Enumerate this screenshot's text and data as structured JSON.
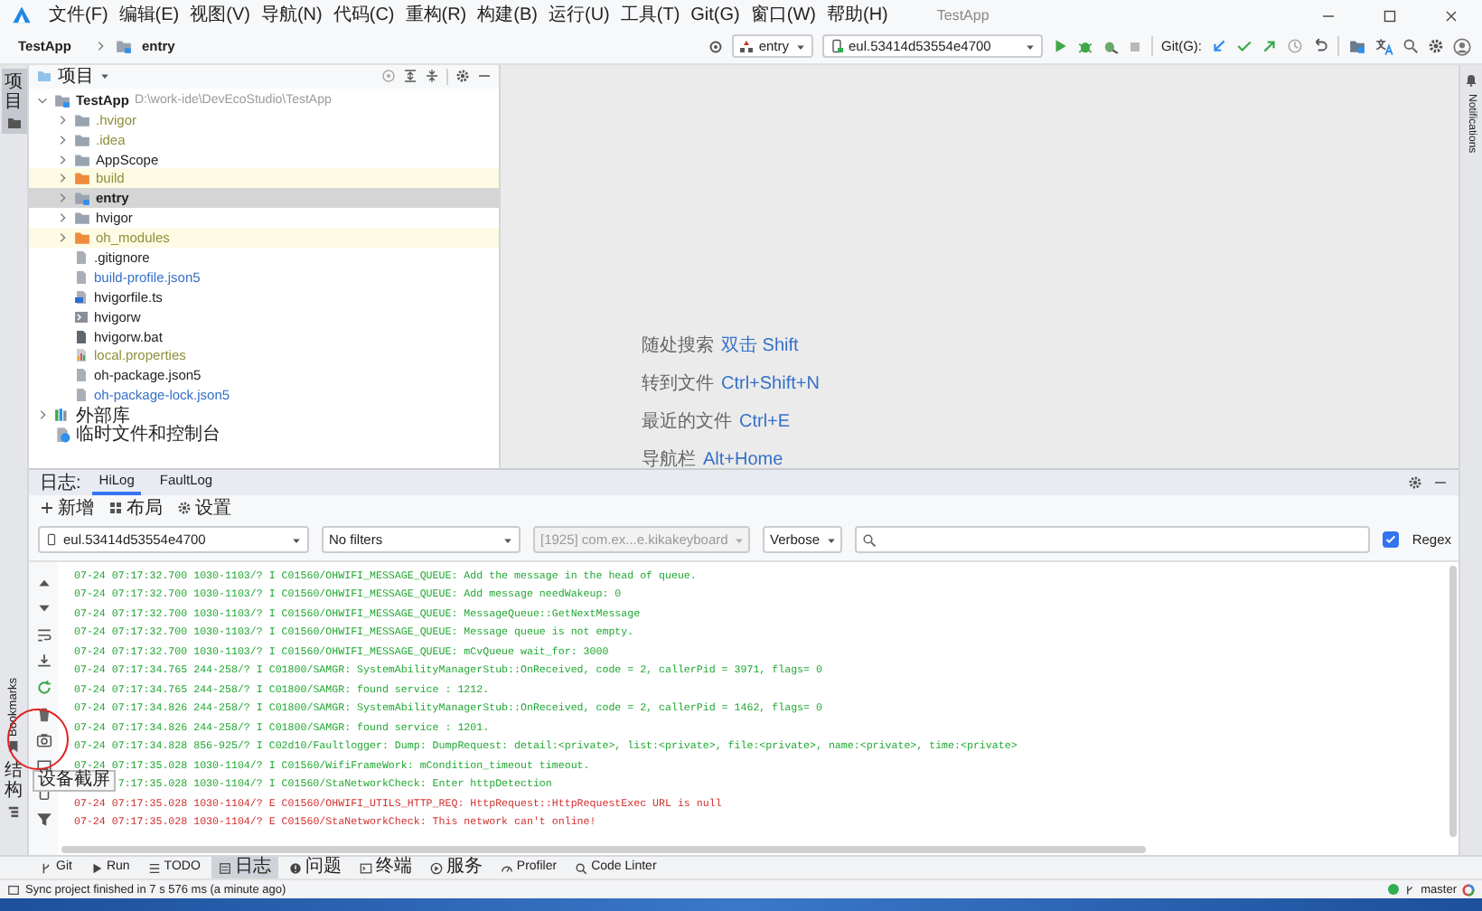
{
  "title_bar": {
    "menus": [
      "文件(F)",
      "编辑(E)",
      "视图(V)",
      "导航(N)",
      "代码(C)",
      "重构(R)",
      "构建(B)",
      "运行(U)",
      "工具(T)",
      "Git(G)",
      "窗口(W)",
      "帮助(H)"
    ],
    "title": "TestApp"
  },
  "navigation_bar": {
    "breadcrumbs": [
      "TestApp",
      "entry"
    ],
    "run_config": "entry",
    "device": "eul.53414d53554e4700",
    "git_label": "Git(G):"
  },
  "left_strip": {
    "tabs": [
      {
        "label": "项目",
        "kind": "vertical-cjk",
        "selected": true
      },
      {
        "label": "Bookmarks",
        "kind": "rotated",
        "selected": false
      },
      {
        "label": "结构",
        "kind": "vertical-cjk",
        "selected": false
      }
    ]
  },
  "right_strip": {
    "tabs": [
      "Notifications"
    ]
  },
  "project_panel": {
    "view": "项目",
    "tree": [
      {
        "name": "TestApp",
        "path": "D:\\work-ide\\DevEcoStudio\\TestApp",
        "kind": "module",
        "ignored": false,
        "modified": false,
        "selected": false,
        "excluded": false,
        "expanded": true,
        "children": [
          {
            "name": ".hvigor",
            "kind": "folder",
            "ignored": true,
            "modified": false,
            "selected": false,
            "excluded": false,
            "expanded": false
          },
          {
            "name": ".idea",
            "kind": "folder",
            "ignored": true,
            "modified": false,
            "selected": false,
            "excluded": false,
            "expanded": false
          },
          {
            "name": "AppScope",
            "kind": "folder",
            "ignored": false,
            "modified": false,
            "selected": false,
            "excluded": false,
            "expanded": false
          },
          {
            "name": "build",
            "kind": "excluded-folder",
            "ignored": true,
            "modified": false,
            "selected": false,
            "excluded": true,
            "expanded": false
          },
          {
            "name": "entry",
            "kind": "module",
            "ignored": false,
            "modified": false,
            "selected": true,
            "excluded": false,
            "expanded": false
          },
          {
            "name": "hvigor",
            "kind": "folder",
            "ignored": false,
            "modified": false,
            "selected": false,
            "excluded": false,
            "expanded": false
          },
          {
            "name": "oh_modules",
            "kind": "excluded-folder",
            "ignored": true,
            "modified": false,
            "selected": false,
            "excluded": true,
            "expanded": false
          },
          {
            "name": ".gitignore",
            "kind": "file",
            "ignored": false,
            "modified": false,
            "selected": false,
            "excluded": false
          },
          {
            "name": "build-profile.json5",
            "kind": "file",
            "ignored": false,
            "modified": true,
            "selected": false,
            "excluded": false
          },
          {
            "name": "hvigorfile.ts",
            "kind": "ts",
            "ignored": false,
            "modified": false,
            "selected": false,
            "excluded": false
          },
          {
            "name": "hvigorw",
            "kind": "script",
            "ignored": false,
            "modified": false,
            "selected": false,
            "excluded": false
          },
          {
            "name": "hvigorw.bat",
            "kind": "bat",
            "ignored": false,
            "modified": false,
            "selected": false,
            "excluded": false
          },
          {
            "name": "local.properties",
            "kind": "properties",
            "ignored": true,
            "modified": false,
            "selected": false,
            "excluded": false
          },
          {
            "name": "oh-package.json5",
            "kind": "file",
            "ignored": false,
            "modified": false,
            "selected": false,
            "excluded": false
          },
          {
            "name": "oh-package-lock.json5",
            "kind": "file",
            "ignored": false,
            "modified": true,
            "selected": false,
            "excluded": false
          }
        ]
      },
      {
        "name": "外部库",
        "kind": "library",
        "ignored": false,
        "modified": false,
        "selected": false,
        "excluded": false,
        "expanded": false
      },
      {
        "name": "临时文件和控制台",
        "kind": "scratch",
        "ignored": false,
        "modified": false,
        "selected": false,
        "excluded": false
      }
    ]
  },
  "editor_hints": [
    {
      "action": "随处搜索",
      "shortcut": "双击 Shift"
    },
    {
      "action": "转到文件",
      "shortcut": "Ctrl+Shift+N"
    },
    {
      "action": "最近的文件",
      "shortcut": "Ctrl+E"
    },
    {
      "action": "导航栏",
      "shortcut": "Alt+Home"
    }
  ],
  "log_panel": {
    "label": "日志:",
    "tabs": [
      {
        "label": "HiLog",
        "selected": true
      },
      {
        "label": "FaultLog",
        "selected": false
      }
    ],
    "actions": [
      "新增",
      "布局",
      "设置"
    ],
    "device": "eul.53414d53554e4700",
    "filter": "No filters",
    "process": {
      "text": "[1925] com.ex...e.kikakeyboard",
      "disabled": true
    },
    "log_level": "Verbose",
    "regex": {
      "label": "Regex",
      "checked": true
    },
    "lines": [
      {
        "kind": "info",
        "covered": false,
        "text": "07-24 07:17:32.700 1030-1103/? I C01560/OHWIFI_MESSAGE_QUEUE: Add the message in the head of queue."
      },
      {
        "kind": "info",
        "covered": false,
        "text": "07-24 07:17:32.700 1030-1103/? I C01560/OHWIFI_MESSAGE_QUEUE: Add message needWakeup: 0"
      },
      {
        "kind": "info",
        "covered": false,
        "text": "07-24 07:17:32.700 1030-1103/? I C01560/OHWIFI_MESSAGE_QUEUE: MessageQueue::GetNextMessage"
      },
      {
        "kind": "info",
        "covered": false,
        "text": "07-24 07:17:32.700 1030-1103/? I C01560/OHWIFI_MESSAGE_QUEUE: Message queue is not empty."
      },
      {
        "kind": "info",
        "covered": false,
        "text": "07-24 07:17:32.700 1030-1103/? I C01560/OHWIFI_MESSAGE_QUEUE: mCvQueue wait_for: 3000"
      },
      {
        "kind": "info",
        "covered": false,
        "text": "07-24 07:17:34.765 244-258/? I C01800/SAMGR: SystemAbilityManagerStub::OnReceived, code = 2, callerPid = 3971, flags= 0"
      },
      {
        "kind": "info",
        "covered": false,
        "text": "07-24 07:17:34.765 244-258/? I C01800/SAMGR: found service : 1212."
      },
      {
        "kind": "info",
        "covered": false,
        "text": "07-24 07:17:34.826 244-258/? I C01800/SAMGR: SystemAbilityManagerStub::OnReceived, code = 2, callerPid = 1462, flags= 0"
      },
      {
        "kind": "info",
        "covered": false,
        "text": "07-24 07:17:34.826 244-258/? I C01800/SAMGR: found service : 1201."
      },
      {
        "kind": "info",
        "covered": false,
        "text": "07-24 07:17:34.828 856-925/? I C02d10/Faultlogger: Dump: DumpRequest: detail:<private>, list:<private>, file:<private>, name:<private>, time:<private>"
      },
      {
        "kind": "info",
        "covered": false,
        "text": "07-24 07:17:35.028 1030-1104/? I C01560/WifiFrameWork: mCondition_timeout timeout."
      },
      {
        "kind": "info",
        "covered": true,
        "text": "7:17:35.028 1030-1104/? I C01560/StaNetworkCheck: Enter httpDetection"
      },
      {
        "kind": "error",
        "covered": false,
        "text": "07-24 07:17:35.028 1030-1104/? E C01560/OHWIFI_UTILS_HTTP_REQ: HttpRequest::HttpRequestExec URL is null"
      },
      {
        "kind": "error",
        "covered": false,
        "text": "07-24 07:17:35.028 1030-1104/? E C01560/StaNetworkCheck: This network can't online!"
      }
    ],
    "tooltip": "设备截屏"
  },
  "bottom_tools": [
    {
      "label": "Git",
      "kind": "git",
      "selected": false
    },
    {
      "label": "Run",
      "kind": "run",
      "selected": false
    },
    {
      "label": "TODO",
      "kind": "list",
      "selected": false
    },
    {
      "label": "日志",
      "kind": "log",
      "selected": true
    },
    {
      "label": "问题",
      "kind": "problems",
      "selected": false
    },
    {
      "label": "终端",
      "kind": "terminal",
      "selected": false
    },
    {
      "label": "服务",
      "kind": "services",
      "selected": false
    },
    {
      "label": "Profiler",
      "kind": "profiler",
      "selected": false
    },
    {
      "label": "Code Linter",
      "kind": "linter",
      "selected": false
    }
  ],
  "status_bar": {
    "message": "Sync project finished in 7 s 576 ms (a minute ago)",
    "branch": "master"
  }
}
